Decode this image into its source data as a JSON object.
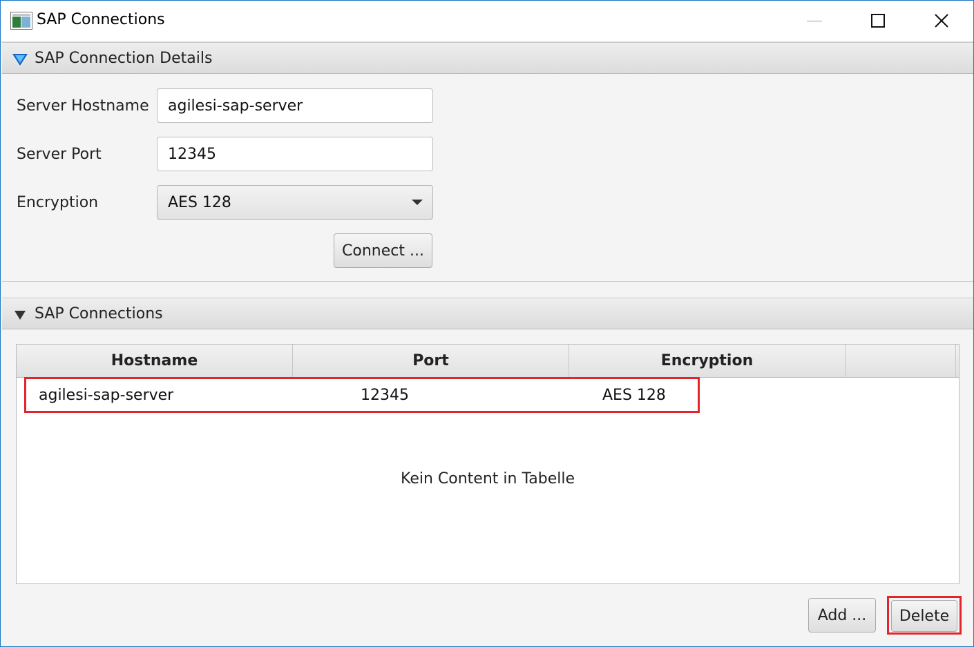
{
  "window": {
    "title": "SAP Connections",
    "accent_border": "#1a78c8"
  },
  "details_section": {
    "title": "SAP Connection Details",
    "hostname_label": "Server Hostname",
    "hostname_value": "agilesi-sap-server",
    "port_label": "Server Port",
    "port_value": "12345",
    "encryption_label": "Encryption",
    "encryption_value": "AES 128",
    "connect_button": "Connect ..."
  },
  "connections_section": {
    "title": "SAP Connections",
    "columns": [
      "Hostname",
      "Port",
      "Encryption"
    ],
    "rows": [
      {
        "hostname": "agilesi-sap-server",
        "port": "12345",
        "encryption": "AES 128"
      }
    ],
    "empty_text": "Kein Content in Tabelle",
    "add_button": "Add ...",
    "delete_button": "Delete",
    "highlight_color": "#e2242c"
  }
}
